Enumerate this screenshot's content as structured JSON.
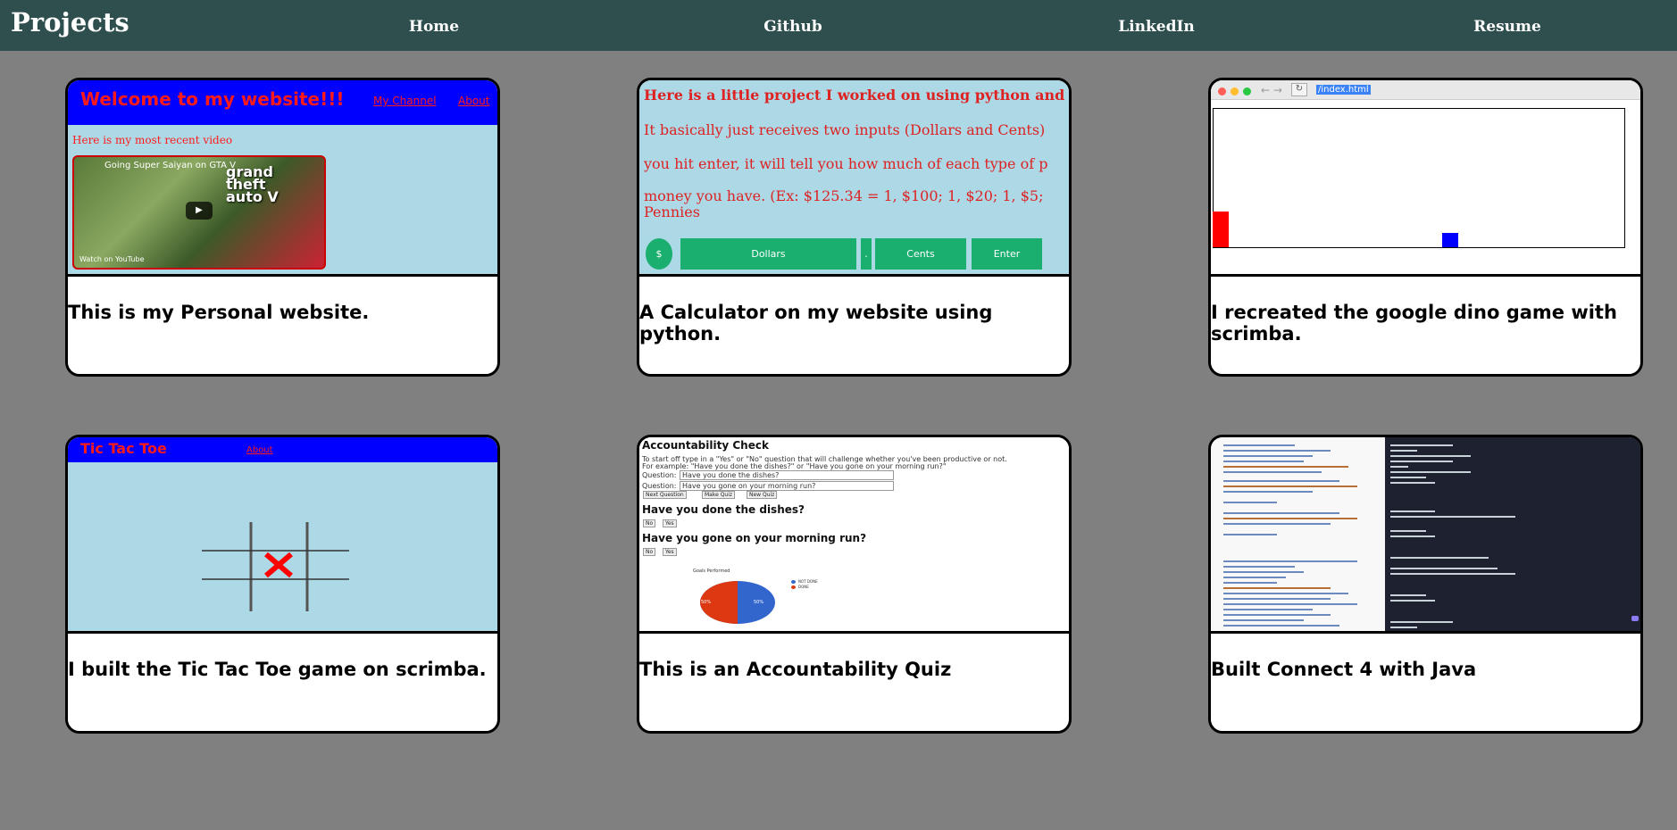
{
  "nav": {
    "title": "Projects",
    "links": [
      "Home",
      "Github",
      "LinkedIn",
      "Resume"
    ]
  },
  "cards": [
    {
      "caption": "This is my Personal website.",
      "thumb": {
        "heading": "Welcome to my website!!!",
        "links": [
          "My Channel",
          "About"
        ],
        "subtext": "Here is my most recent video",
        "video_title": "Going Super Saiyan on GTA V",
        "video_logo": "Grand Theft Auto V",
        "watch_on": "Watch on YouTube"
      }
    },
    {
      "caption": "A Calculator on my website using python.",
      "thumb": {
        "heading": "Here is a little project I worked on using python and",
        "lines": [
          "It basically just receives two inputs (Dollars and Cents)",
          "you hit enter, it will tell you how much of each type of p",
          "money you have. (Ex: $125.34 = 1, $100; 1, $20; 1, $5;",
          "Pennies"
        ],
        "buttons": [
          "$",
          "Dollars",
          ".",
          "Cents",
          "Enter"
        ]
      }
    },
    {
      "caption": "I recreated the google dino game with scrimba.",
      "thumb": {
        "url": "/index.html"
      }
    },
    {
      "caption": "I built the Tic Tac Toe game on scrimba.",
      "thumb": {
        "heading": "Tic Tac Toe",
        "link": "About"
      }
    },
    {
      "caption": "This is an Accountability Quiz",
      "thumb": {
        "heading": "Accountability Check",
        "intro": "To start off type in a \"Yes\" or \"No\" question that will challenge whether you've been productive or not.",
        "example": "For example: \"Have you done the dishes?\" or \"Have you gone on your morning run?\"",
        "field_label": "Question:",
        "field_values": [
          "Have you done the dishes?",
          "Have you gone on your morning run?"
        ],
        "buttons": [
          "Next Question",
          "Make Quiz",
          "New Quiz"
        ],
        "questions": [
          "Have you done the dishes?",
          "Have you gone on your morning run?"
        ],
        "answer_buttons": [
          "No",
          "Yes"
        ],
        "pie_title": "Goals Performed",
        "pie_legend": [
          "NOT DONE",
          "DONE"
        ],
        "pie_values": [
          "50%",
          "50%"
        ]
      }
    },
    {
      "caption": "Built Connect 4 with Java",
      "thumb": {}
    }
  ]
}
